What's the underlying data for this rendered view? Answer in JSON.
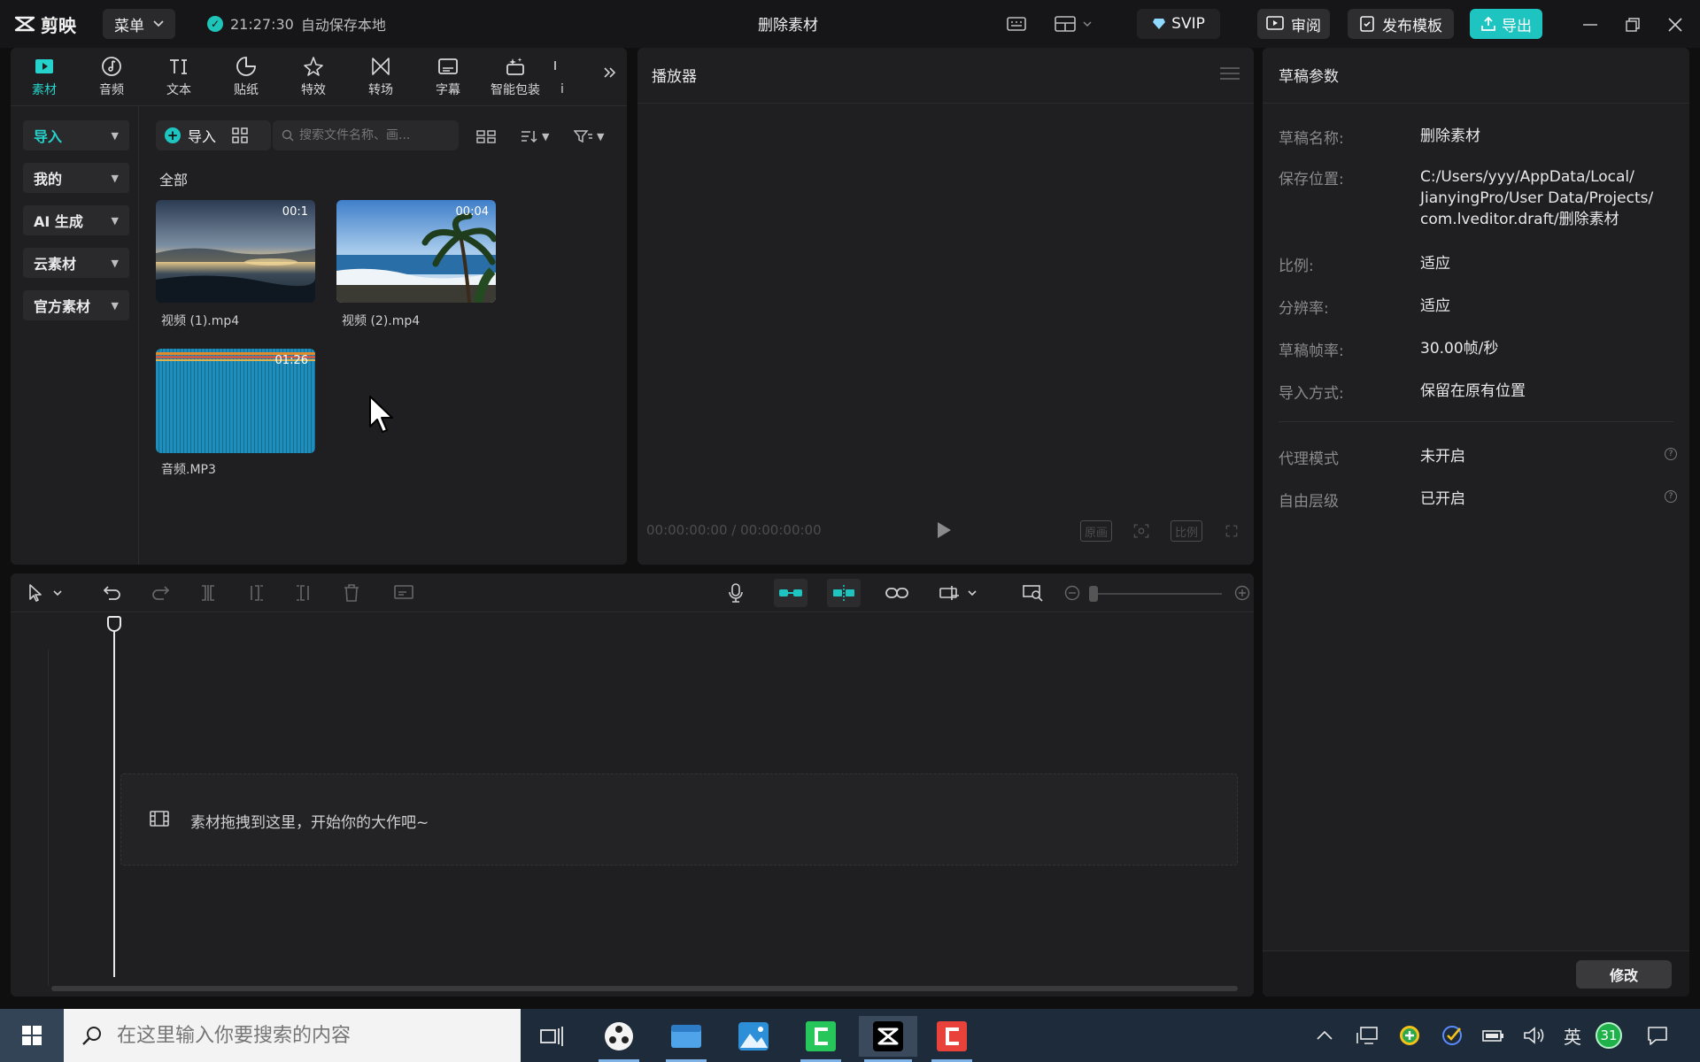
{
  "titlebar": {
    "app_name": "剪映",
    "menu_label": "菜单",
    "autosave_time": "21:27:30",
    "autosave_text": "自动保存本地",
    "document_title": "删除素材",
    "svip_label": "SVIP",
    "review_label": "审阅",
    "publish_template_label": "发布模板",
    "export_label": "导出"
  },
  "media": {
    "tabs": [
      {
        "label": "素材",
        "icon": "media-play-icon"
      },
      {
        "label": "音频",
        "icon": "audio-note-icon"
      },
      {
        "label": "文本",
        "icon": "text-ti-icon"
      },
      {
        "label": "贴纸",
        "icon": "sticker-icon"
      },
      {
        "label": "特效",
        "icon": "effects-star-icon"
      },
      {
        "label": "转场",
        "icon": "transition-icon"
      },
      {
        "label": "字幕",
        "icon": "subtitle-icon"
      },
      {
        "label": "智能包装",
        "icon": "smart-pack-icon"
      },
      {
        "label": "i",
        "icon": "more-tab-icon"
      }
    ],
    "nav": [
      {
        "label": "导入"
      },
      {
        "label": "我的"
      },
      {
        "label": "AI 生成"
      },
      {
        "label": "云素材"
      },
      {
        "label": "官方素材"
      }
    ],
    "import_button": "导入",
    "search_placeholder": "搜索文件名称、画...",
    "section_label": "全部",
    "items": [
      {
        "name": "视频 (1).mp4",
        "duration": "00:1"
      },
      {
        "name": "视频 (2).mp4",
        "duration": "00:04"
      },
      {
        "name": "音频.MP3",
        "duration": "01:26"
      }
    ]
  },
  "player": {
    "title": "播放器",
    "time_current": "00:00:00:00",
    "time_total": "00:00:00:00",
    "quality_label": "原画",
    "ratio_label": "比例"
  },
  "params": {
    "title": "草稿参数",
    "rows": [
      {
        "label": "草稿名称:",
        "value": "删除素材"
      },
      {
        "label": "保存位置:",
        "value": "C:/Users/yyy/AppData/Local/\nJianyingPro/User Data/Projects/\ncom.lveditor.draft/删除素材"
      },
      {
        "label": "比例:",
        "value": "适应"
      },
      {
        "label": "分辨率:",
        "value": "适应"
      },
      {
        "label": "草稿帧率:",
        "value": "30.00帧/秒"
      },
      {
        "label": "导入方式:",
        "value": "保留在原有位置"
      },
      {
        "label": "代理模式",
        "value": "未开启"
      },
      {
        "label": "自由层级",
        "value": "已开启"
      }
    ],
    "modify_button": "修改"
  },
  "timeline": {
    "drop_hint": "素材拖拽到这里，开始你的大作吧~"
  },
  "taskbar": {
    "search_placeholder": "在这里输入你要搜索的内容",
    "ime_label": "英",
    "date_badge": "31"
  },
  "colors": {
    "accent": "#1ec4c0",
    "panel_bg": "#1f1f21",
    "app_bg": "#0f0f10"
  }
}
